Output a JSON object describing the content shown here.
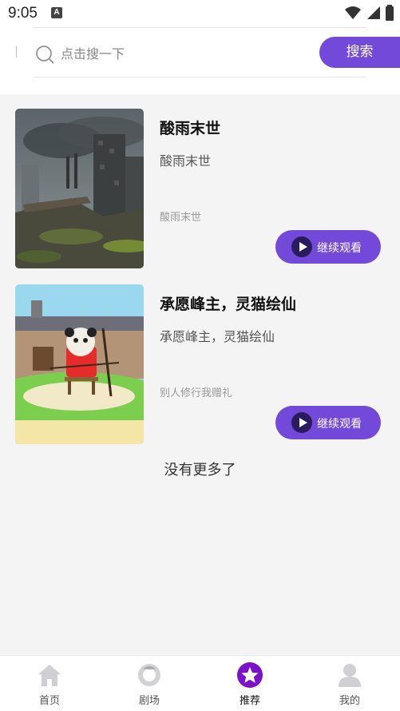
{
  "status_bar": {
    "time": "9:05"
  },
  "search": {
    "placeholder": "点击搜一下",
    "button_label": "搜索"
  },
  "items": [
    {
      "title": "酸雨末世",
      "subtitle": "酸雨末世",
      "desc": "酸雨末世",
      "button_label": "继续观看"
    },
    {
      "title": "承愿峰主，灵猫绘仙",
      "subtitle": "承愿峰主，灵猫绘仙",
      "desc": "别人修行我赠礼",
      "button_label": "继续观看"
    }
  ],
  "no_more_text": "没有更多了",
  "bottom_nav": [
    {
      "label": "首页",
      "icon": "home-icon"
    },
    {
      "label": "剧场",
      "icon": "theater-icon"
    },
    {
      "label": "推荐",
      "icon": "star-icon",
      "active": true
    },
    {
      "label": "我的",
      "icon": "profile-icon"
    }
  ],
  "colors": {
    "accent": "#7349d9",
    "background": "#f4f4f5"
  }
}
